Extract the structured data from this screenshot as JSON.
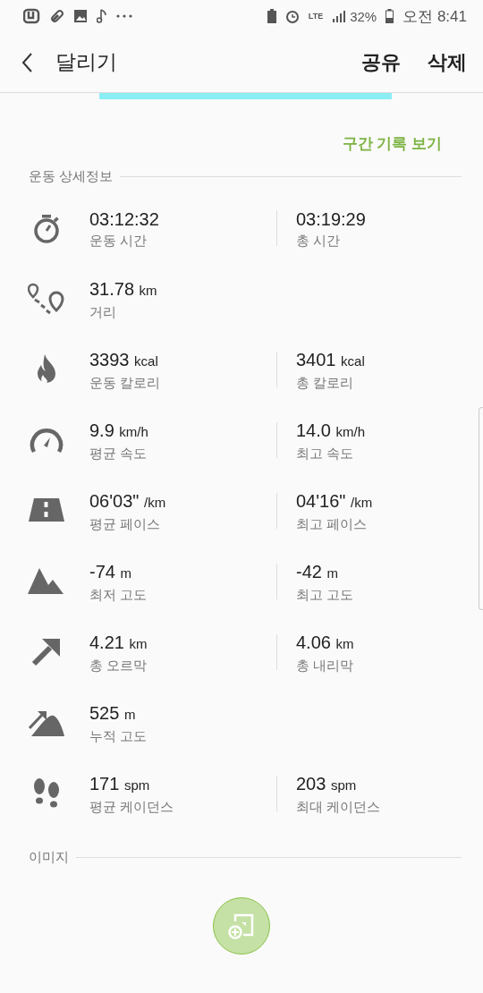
{
  "status_bar": {
    "network": "LTE",
    "battery": "32%",
    "time": "오전 8:41"
  },
  "header": {
    "title": "달리기",
    "actions": [
      "공유",
      "삭제"
    ]
  },
  "section_link": "구간 기록 보기",
  "details": {
    "title": "운동 상세정보",
    "rows": [
      {
        "kind": "stopwatch",
        "left": {
          "value": "03:12:32",
          "label": "운동 시간"
        },
        "right": {
          "value": "03:19:29",
          "label": "총 시간"
        }
      },
      {
        "kind": "route",
        "left": {
          "value": "31.78",
          "unit": "km",
          "label": "거리"
        }
      },
      {
        "kind": "flame",
        "left": {
          "value": "3393",
          "unit": "kcal",
          "label": "운동 칼로리"
        },
        "right": {
          "value": "3401",
          "unit": "kcal",
          "label": "총 칼로리"
        }
      },
      {
        "kind": "speedometer",
        "left": {
          "value": "9.9",
          "unit": "km/h",
          "label": "평균 속도"
        },
        "right": {
          "value": "14.0",
          "unit": "km/h",
          "label": "최고 속도"
        }
      },
      {
        "kind": "road",
        "left": {
          "value": "06'03\"",
          "unit": "/km",
          "label": "평균 페이스"
        },
        "right": {
          "value": "04'16\"",
          "unit": "/km",
          "label": "최고 페이스"
        }
      },
      {
        "kind": "mountain",
        "left": {
          "value": "-74",
          "unit": "m",
          "label": "최저 고도"
        },
        "right": {
          "value": "-42",
          "unit": "m",
          "label": "최고 고도"
        }
      },
      {
        "kind": "arrow",
        "left": {
          "value": "4.21",
          "unit": "km",
          "label": "총 오르막"
        },
        "right": {
          "value": "4.06",
          "unit": "km",
          "label": "총 내리막"
        }
      },
      {
        "kind": "climb",
        "left": {
          "value": "525",
          "unit": "m",
          "label": "누적 고도"
        }
      },
      {
        "kind": "footprints",
        "left": {
          "value": "171",
          "unit": "spm",
          "label": "평균 케이던스"
        },
        "right": {
          "value": "203",
          "unit": "spm",
          "label": "최대 케이던스"
        }
      }
    ]
  },
  "images": {
    "title": "이미지"
  }
}
